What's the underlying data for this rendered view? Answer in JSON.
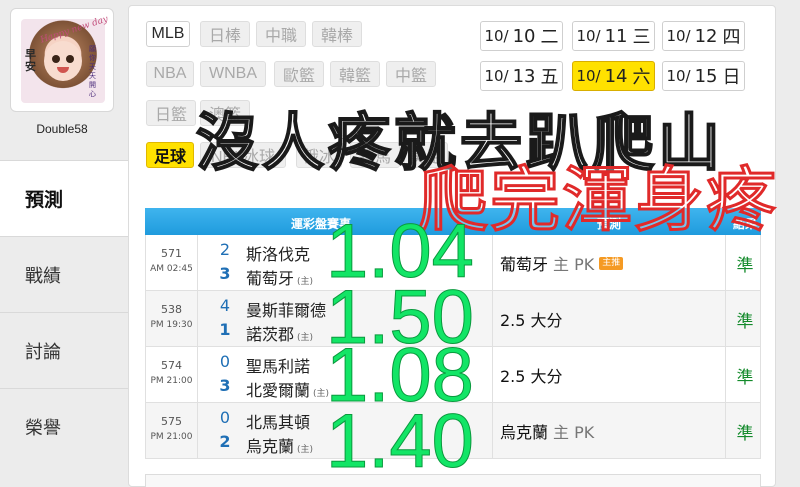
{
  "profile": {
    "username": "Double58",
    "avatar_text_top": "Happy new day",
    "avatar_text_left": "早安",
    "avatar_text_right": "願你天天開心"
  },
  "nav": {
    "items": [
      "預測",
      "戰績",
      "討論",
      "榮譽"
    ]
  },
  "sports": {
    "chips": [
      {
        "label": "MLB",
        "state": "normal"
      },
      {
        "label": "日棒",
        "state": "dim"
      },
      {
        "label": "中職",
        "state": "dim"
      },
      {
        "label": "韓棒",
        "state": "dim"
      },
      {
        "label": "NBA",
        "state": "dim"
      },
      {
        "label": "WNBA",
        "state": "dim"
      },
      {
        "label": "歐籃",
        "state": "dim"
      },
      {
        "label": "韓籃",
        "state": "dim"
      },
      {
        "label": "中籃",
        "state": "dim"
      },
      {
        "label": "日籃",
        "state": "dim"
      },
      {
        "label": "澳籃",
        "state": "dim"
      },
      {
        "label": "足球",
        "state": "selected"
      },
      {
        "label": "NHL冰球",
        "state": "dim"
      },
      {
        "label": "俄冰",
        "state": "dim"
      },
      {
        "label": "賽馬",
        "state": "dim"
      },
      {
        "label": "美足",
        "state": "dim"
      }
    ]
  },
  "dates": [
    {
      "md": "10/",
      "day": "10",
      "dow": "二"
    },
    {
      "md": "10/",
      "day": "11",
      "dow": "三"
    },
    {
      "md": "10/",
      "day": "12",
      "dow": "四"
    },
    {
      "md": "10/",
      "day": "13",
      "dow": "五"
    },
    {
      "md": "10/",
      "day": "14",
      "dow": "六",
      "selected": true
    },
    {
      "md": "10/",
      "day": "15",
      "dow": "日"
    }
  ],
  "table": {
    "headers": {
      "event": "運彩盤賽事",
      "prediction": "預測",
      "result": "結果"
    },
    "home_tag": "(主)",
    "rows": [
      {
        "no": "571",
        "time": "AM 02:45",
        "away": "斯洛伐克",
        "home": "葡萄牙",
        "away_score": "2",
        "home_score": "3",
        "pick": "葡萄牙",
        "pick_extra": "主 PK",
        "badge": "主推",
        "result": "準"
      },
      {
        "no": "538",
        "time": "PM 19:30",
        "away": "曼斯菲爾德",
        "home": "諾茨郡",
        "away_score": "4",
        "home_score": "1",
        "pick": "2.5 大分",
        "pick_extra": "",
        "badge": "",
        "result": "準"
      },
      {
        "no": "574",
        "time": "PM 21:00",
        "away": "聖馬利諾",
        "home": "北愛爾蘭",
        "away_score": "0",
        "home_score": "3",
        "pick": "2.5 大分",
        "pick_extra": "",
        "badge": "",
        "result": "準"
      },
      {
        "no": "575",
        "time": "PM 21:00",
        "away": "北馬其頓",
        "home": "烏克蘭",
        "away_score": "0",
        "home_score": "2",
        "pick": "烏克蘭",
        "pick_extra": "主 PK",
        "badge": "",
        "result": "準"
      }
    ]
  },
  "overlay": {
    "line1": "沒人疼就去趴爬山",
    "line2": "爬完渾身疼",
    "odds": [
      "1.04",
      "1.50",
      "1.08",
      "1.40"
    ]
  },
  "colors": {
    "accent_yellow": "#ffe100",
    "table_header": "#1f9bdd",
    "hit_green": "#138a2b",
    "overlay_green": "#12e566",
    "overlay_red": "#e02a2a"
  }
}
